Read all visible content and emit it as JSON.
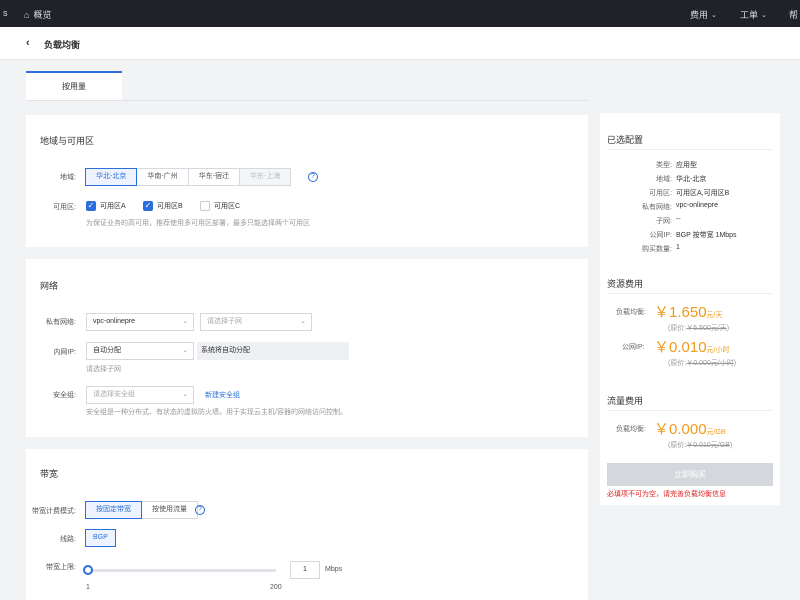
{
  "topbar": {
    "edge_glyph": "s",
    "home_label": "概览",
    "nav": [
      {
        "label": "费用"
      },
      {
        "label": "工单"
      },
      {
        "label": "帮"
      }
    ]
  },
  "header": {
    "title": "负载均衡"
  },
  "tabs": [
    {
      "label": "按用量"
    }
  ],
  "region_section": {
    "title": "地域与可用区",
    "region_label": "地域:",
    "regions": [
      "华北-北京",
      "华南-广州",
      "华东-宿迁",
      "华东-上海"
    ],
    "zone_label": "可用区:",
    "zones": [
      {
        "label": "可用区A",
        "checked": true
      },
      {
        "label": "可用区B",
        "checked": true
      },
      {
        "label": "可用区C",
        "checked": false
      }
    ],
    "zone_hint": "为保证业务的高可用，推荐使用多可用区部署，最多只能选择两个可用区"
  },
  "network_section": {
    "title": "网络",
    "vpc_label": "私有网络:",
    "vpc_value": "vpc-onlinepre",
    "subnet_placeholder": "请选择子网",
    "ip_label": "内网IP:",
    "ip_value": "自动分配",
    "ip_note": "系统将自动分配",
    "ip_hint": "请选择子网",
    "sg_label": "安全组:",
    "sg_placeholder": "请选择安全组",
    "sg_link": "新建安全组",
    "sg_hint": "安全组是一种分布式、有状态的虚拟防火墙，用于实现云主机/容器的网络访问控制。"
  },
  "bandwidth_section": {
    "title": "带宽",
    "billing_label": "带宽计费模式:",
    "billing_options": [
      "按固定带宽",
      "按使用流量"
    ],
    "line_label": "线路:",
    "line_value": "BGP",
    "limit_label": "带宽上限:",
    "limit_min": "1",
    "limit_max": "200",
    "limit_value": "1",
    "limit_unit": "Mbps",
    "limit_level": 0
  },
  "summary": {
    "config_title": "已选配置",
    "config": [
      {
        "k": "类型:",
        "v": "应用型"
      },
      {
        "k": "地域:",
        "v": "华北-北京"
      },
      {
        "k": "可用区:",
        "v": "可用区A,可用区B"
      },
      {
        "k": "私有网络:",
        "v": "vpc-onlinepre"
      },
      {
        "k": "子网:",
        "v": "--"
      },
      {
        "k": "公网IP:",
        "v": "BGP 按带宽 1Mbps"
      },
      {
        "k": "购买数量:",
        "v": "1"
      }
    ],
    "resource_title": "资源费用",
    "lb_label": "负载均衡:",
    "lb_price": "￥1.650",
    "lb_unit": "元/天",
    "lb_orig_label": "(原价:",
    "lb_orig": "￥5.500元/天",
    "lb_orig_close": ")",
    "ip_label": "公网IP:",
    "ip_price": "￥0.010",
    "ip_unit": "元/小时",
    "ip_orig_label": "(原价:",
    "ip_orig": "￥0.000元/小时",
    "ip_orig_close": ")",
    "traffic_title": "流量费用",
    "traffic_label": "负载均衡:",
    "traffic_price": "￥0.000",
    "traffic_unit": "元/GB",
    "traffic_orig_label": "(原价:",
    "traffic_orig": "￥0.010元/GB",
    "traffic_orig_close": ")",
    "buy_label": "立即购买",
    "error": "必填项不可为空，请完善负载均衡信息"
  },
  "colors": {
    "accent": "#2a6fdb",
    "price": "#f09a1a",
    "error": "#e02020",
    "topbar": "#1f2329"
  }
}
